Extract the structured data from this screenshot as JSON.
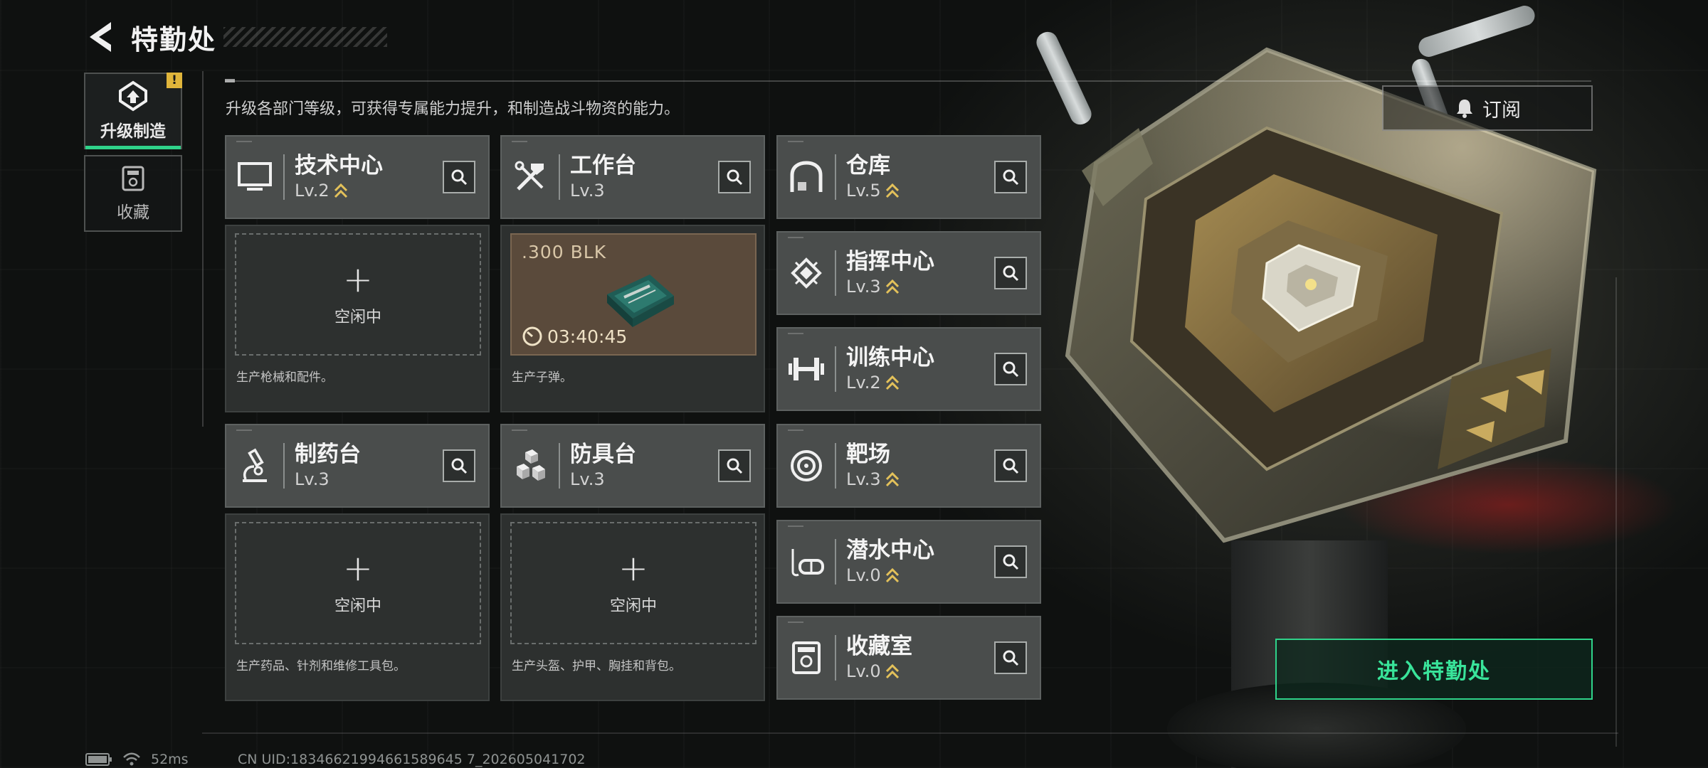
{
  "header": {
    "title": "特勤处"
  },
  "nav": {
    "items": [
      {
        "label": "升级制造",
        "badge": "!"
      },
      {
        "label": "收藏"
      }
    ]
  },
  "description": "升级各部门等级，可获得专属能力提升，和制造战斗物资的能力。",
  "subscribe": {
    "label": "订阅"
  },
  "cards": {
    "tech": {
      "name": "技术中心",
      "level": "Lv.2",
      "idle_label": "空闲中",
      "hint": "生产枪械和配件。"
    },
    "workbench": {
      "name": "工作台",
      "level": "Lv.3",
      "ammo": ".300 BLK",
      "timer": "03:40:45",
      "hint": "生产子弹。"
    },
    "pharmacy": {
      "name": "制药台",
      "level": "Lv.3",
      "idle_label": "空闲中",
      "hint": "生产药品、针剂和维修工具包。"
    },
    "armor": {
      "name": "防具台",
      "level": "Lv.3",
      "idle_label": "空闲中",
      "hint": "生产头盔、护甲、胸挂和背包。"
    },
    "warehouse": {
      "name": "仓库",
      "level": "Lv.5"
    },
    "command": {
      "name": "指挥中心",
      "level": "Lv.3"
    },
    "training": {
      "name": "训练中心",
      "level": "Lv.2"
    },
    "range": {
      "name": "靶场",
      "level": "Lv.3"
    },
    "diving": {
      "name": "潜水中心",
      "level": "Lv.0"
    },
    "collection": {
      "name": "收藏室",
      "level": "Lv.0"
    }
  },
  "enter_button": {
    "label": "进入特勤处"
  },
  "status": {
    "ping": "52ms",
    "uid": "CN UID:18346621994661589645 7_202605041702"
  },
  "colors": {
    "accent": "#2fd38a",
    "level_arrow": "#e3c15a",
    "card_head": "#4a4d4c",
    "card_body": "#2d302f"
  }
}
